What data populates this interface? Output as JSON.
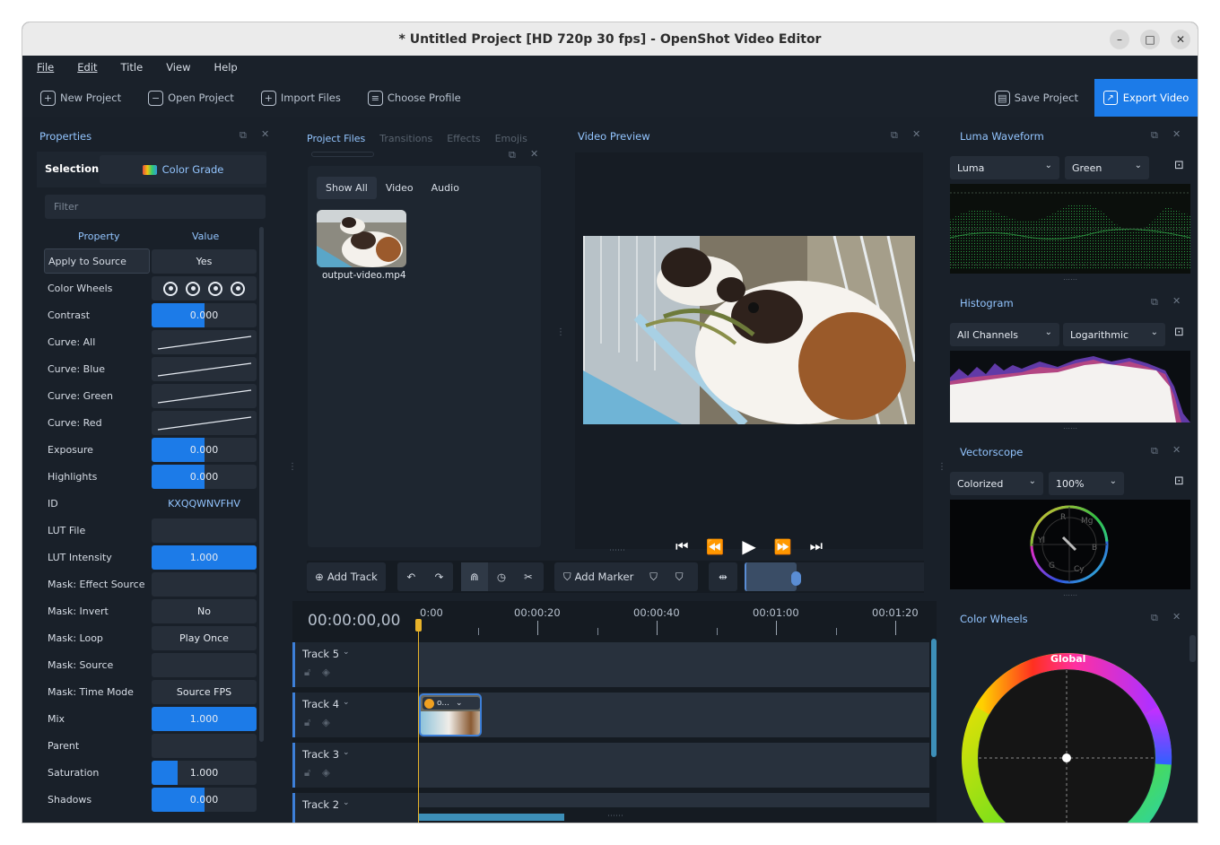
{
  "window": {
    "title": "* Untitled Project [HD 720p 30 fps] - OpenShot Video Editor",
    "controls": [
      "–",
      "□",
      "✕"
    ]
  },
  "menu": [
    "File",
    "Edit",
    "Title",
    "View",
    "Help"
  ],
  "toolbar": {
    "new_project": "New Project",
    "open_project": "Open Project",
    "import_files": "Import Files",
    "choose_profile": "Choose Profile",
    "save_project": "Save Project",
    "export_video": "Export Video"
  },
  "properties": {
    "title": "Properties",
    "selection_label": "Selection:",
    "selection_value": "Color Grade",
    "filter_placeholder": "Filter",
    "col_property": "Property",
    "col_value": "Value",
    "rows": [
      {
        "name": "Apply to Source",
        "value": "Yes",
        "fill": 0
      },
      {
        "name": "Color Wheels",
        "value": "",
        "fill": 0,
        "wheels": true
      },
      {
        "name": "Contrast",
        "value": "0.000",
        "fill": 0.5
      },
      {
        "name": "Curve: All",
        "value": "",
        "fill": 0,
        "curve": true
      },
      {
        "name": "Curve: Blue",
        "value": "",
        "fill": 0,
        "curve": true
      },
      {
        "name": "Curve: Green",
        "value": "",
        "fill": 0,
        "curve": true
      },
      {
        "name": "Curve: Red",
        "value": "",
        "fill": 0,
        "curve": true
      },
      {
        "name": "Exposure",
        "value": "0.000",
        "fill": 0.5
      },
      {
        "name": "Highlights",
        "value": "0.000",
        "fill": 0.5
      },
      {
        "name": "ID",
        "value": "KXQQWNVFHV",
        "fill": 0,
        "plain": true
      },
      {
        "name": "LUT File",
        "value": "",
        "fill": 0
      },
      {
        "name": "LUT Intensity",
        "value": "1.000",
        "fill": 1
      },
      {
        "name": "Mask: Effect Source",
        "value": "",
        "fill": 0
      },
      {
        "name": "Mask: Invert",
        "value": "No",
        "fill": 0
      },
      {
        "name": "Mask: Loop",
        "value": "Play Once",
        "fill": 0
      },
      {
        "name": "Mask: Source",
        "value": "",
        "fill": 0
      },
      {
        "name": "Mask: Time Mode",
        "value": "Source FPS",
        "fill": 0
      },
      {
        "name": "Mix",
        "value": "1.000",
        "fill": 1
      },
      {
        "name": "Parent",
        "value": "",
        "fill": 0
      },
      {
        "name": "Saturation",
        "value": "1.000",
        "fill": 0.25
      },
      {
        "name": "Shadows",
        "value": "0.000",
        "fill": 0.5
      }
    ]
  },
  "project_files": {
    "tabs": [
      "Project Files",
      "Transitions",
      "Effects",
      "Emojis"
    ],
    "filters": [
      "Show All",
      "Video",
      "Audio"
    ],
    "file_name": "output-video.mp4"
  },
  "video_preview": {
    "title": "Video Preview"
  },
  "timeline": {
    "add_track": "Add Track",
    "add_marker": "Add Marker",
    "timecode": "00:00:00,00",
    "ruler": [
      "0:00",
      "00:00:20",
      "00:00:40",
      "00:01:00",
      "00:01:20"
    ],
    "tracks": [
      "Track 5",
      "Track 4",
      "Track 3",
      "Track 2"
    ],
    "clip_label": "o..."
  },
  "scopes": {
    "luma_title": "Luma Waveform",
    "luma_mode": "Luma",
    "luma_color": "Green",
    "histogram_title": "Histogram",
    "hist_channels": "All Channels",
    "hist_scale": "Logarithmic",
    "vectorscope_title": "Vectorscope",
    "vec_mode": "Colorized",
    "vec_zoom": "100%",
    "vec_labels": [
      "R",
      "Mg",
      "B",
      "Cy",
      "G",
      "Yl"
    ],
    "color_wheels_title": "Color Wheels",
    "wheel_label": "Global"
  },
  "colors": {
    "accent": "#1c7be8",
    "panel_title": "#93c5ff",
    "background": "#192029"
  }
}
